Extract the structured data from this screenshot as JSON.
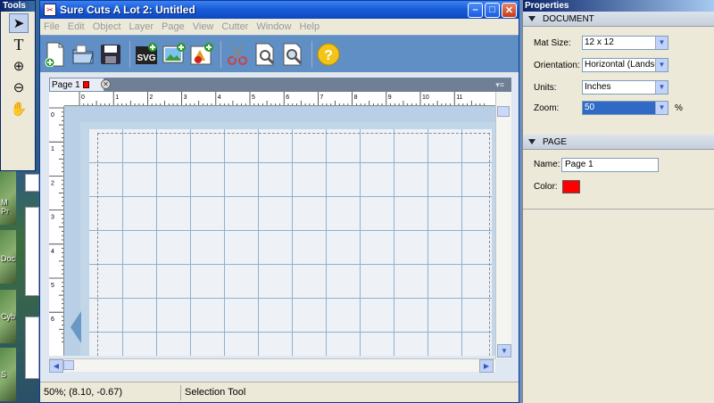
{
  "desktop": {
    "labels": [
      "M",
      "Pr",
      "Doc",
      "Cyb",
      "S"
    ]
  },
  "tools": {
    "title": "Tools",
    "items": [
      {
        "icon": "arrow-select-icon",
        "glyph": "➤"
      },
      {
        "icon": "text-tool-icon",
        "glyph": "T"
      },
      {
        "icon": "zoom-in-icon",
        "glyph": "⊕"
      },
      {
        "icon": "zoom-out-icon",
        "glyph": "⊖"
      },
      {
        "icon": "hand-pan-icon",
        "glyph": "✋"
      }
    ]
  },
  "window": {
    "title": "Sure Cuts A Lot 2: Untitled",
    "buttons": {
      "minimize": "–",
      "maximize": "□",
      "close": "✕"
    }
  },
  "menu": [
    "File",
    "Edit",
    "Object",
    "Layer",
    "Page",
    "View",
    "Cutter",
    "Window",
    "Help"
  ],
  "toolbar": [
    {
      "name": "new-document-icon"
    },
    {
      "name": "open-folder-icon"
    },
    {
      "name": "save-disk-icon"
    },
    {
      "name": "import-svg-icon",
      "text": "SVG"
    },
    {
      "name": "import-image-icon"
    },
    {
      "name": "trace-image-icon"
    },
    {
      "name": "cut-scissors-icon"
    },
    {
      "name": "preview-icon"
    },
    {
      "name": "cut-preview-icon"
    },
    {
      "name": "help-icon",
      "text": "?"
    }
  ],
  "document_tab": {
    "label": "Page 1",
    "close": "✕",
    "menu": "▾≡"
  },
  "ruler": {
    "h_ticks": [
      "0",
      "1",
      "2",
      "3",
      "4",
      "5",
      "6",
      "7",
      "8",
      "9",
      "10",
      "11"
    ],
    "v_ticks": [
      "0",
      "1",
      "2",
      "3",
      "4",
      "5",
      "6"
    ]
  },
  "status": {
    "zoom_coords": "50%; (8.10, -0.67)",
    "tool": "Selection Tool"
  },
  "properties": {
    "title": "Properties",
    "document": {
      "heading": "DOCUMENT",
      "mat_size_label": "Mat Size:",
      "mat_size_value": "12 x 12",
      "orientation_label": "Orientation:",
      "orientation_value": "Horizontal (Landscap",
      "units_label": "Units:",
      "units_value": "Inches",
      "zoom_label": "Zoom:",
      "zoom_value": "50",
      "zoom_unit": "%"
    },
    "page": {
      "heading": "PAGE",
      "name_label": "Name:",
      "name_value": "Page 1",
      "color_label": "Color:",
      "color_value": "#ff0000"
    }
  }
}
